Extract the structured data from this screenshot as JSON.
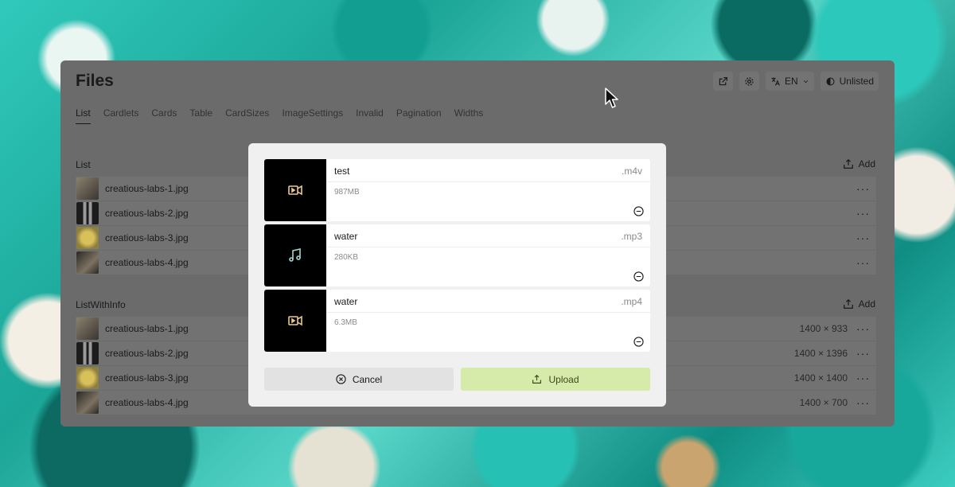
{
  "app": {
    "title": "Files",
    "toolbar": {
      "open_icon": "external-link-icon",
      "settings_icon": "gear-icon",
      "language_label": "EN",
      "visibility_label": "Unlisted"
    },
    "tabs": [
      "List",
      "Cardlets",
      "Cards",
      "Table",
      "CardSizes",
      "ImageSettings",
      "Invalid",
      "Pagination",
      "Widths"
    ],
    "active_tab": "List",
    "sections": [
      {
        "title": "List",
        "add_label": "Add",
        "rows": [
          {
            "name": "creatious-labs-1.jpg",
            "dims": ""
          },
          {
            "name": "creatious-labs-2.jpg",
            "dims": ""
          },
          {
            "name": "creatious-labs-3.jpg",
            "dims": ""
          },
          {
            "name": "creatious-labs-4.jpg",
            "dims": ""
          }
        ]
      },
      {
        "title": "ListWithInfo",
        "add_label": "Add",
        "rows": [
          {
            "name": "creatious-labs-1.jpg",
            "dims": "1400 × 933"
          },
          {
            "name": "creatious-labs-2.jpg",
            "dims": "1400 × 1396"
          },
          {
            "name": "creatious-labs-3.jpg",
            "dims": "1400 × 1400"
          },
          {
            "name": "creatious-labs-4.jpg",
            "dims": "1400 × 700"
          }
        ]
      }
    ],
    "more_label": "···"
  },
  "modal": {
    "files": [
      {
        "name": "test",
        "ext": ".m4v",
        "size": "987MB",
        "icon": "video-icon"
      },
      {
        "name": "water",
        "ext": ".mp3",
        "size": "280KB",
        "icon": "music-icon"
      },
      {
        "name": "water",
        "ext": ".mp4",
        "size": "6.3MB",
        "icon": "video-icon"
      }
    ],
    "cancel_label": "Cancel",
    "upload_label": "Upload"
  },
  "colors": {
    "upload_bg": "#d6eaa9",
    "cancel_bg": "#e2e2e2",
    "icon_accent": "#e8c98f",
    "music_icon": "#9fd8cf"
  }
}
